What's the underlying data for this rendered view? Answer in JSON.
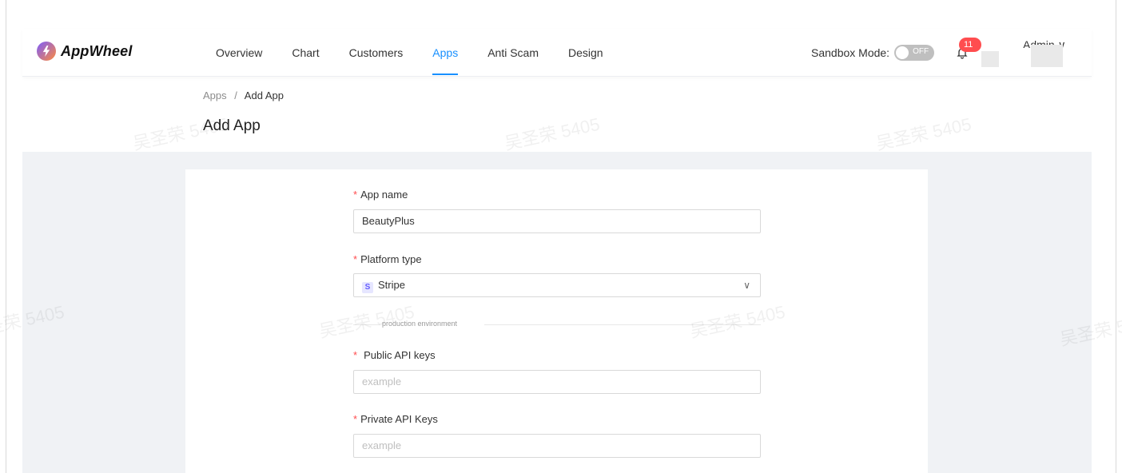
{
  "app": {
    "name": "AppWheel"
  },
  "nav": {
    "items": [
      {
        "label": "Overview",
        "active": false
      },
      {
        "label": "Chart",
        "active": false
      },
      {
        "label": "Customers",
        "active": false
      },
      {
        "label": "Apps",
        "active": true
      },
      {
        "label": "Anti Scam",
        "active": false
      },
      {
        "label": "Design",
        "active": false
      }
    ]
  },
  "header": {
    "sandbox_label": "Sandbox Mode:",
    "sandbox_toggle": "OFF",
    "notification_count": "11",
    "user_menu": "Admin ∨"
  },
  "breadcrumb": {
    "parent": "Apps",
    "separator": "/",
    "current": "Add App"
  },
  "page": {
    "title": "Add App"
  },
  "form": {
    "app_name": {
      "label": "App name",
      "value": "BeautyPlus"
    },
    "platform_type": {
      "label": "Platform type",
      "value": "Stripe",
      "icon_letter": "S"
    },
    "section_divider": "production environment",
    "public_api_keys": {
      "label": "Public API keys",
      "placeholder": "example"
    },
    "private_api_keys": {
      "label": "Private API Keys",
      "placeholder": "example"
    }
  },
  "watermark": {
    "text": "吴圣荣 5405"
  },
  "colors": {
    "accent": "#1890ff",
    "required": "#ff4d4f",
    "background": "#f0f2f5"
  }
}
